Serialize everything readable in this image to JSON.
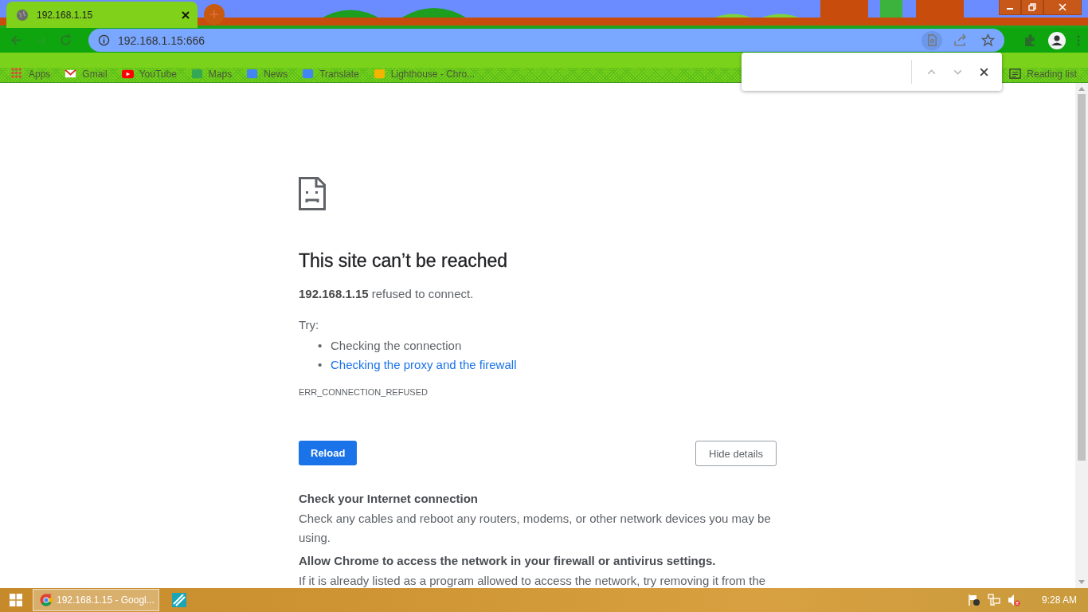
{
  "tab": {
    "title": "192.168.1.15",
    "selected": true
  },
  "toolbar": {
    "url": "192.168.1.15:666"
  },
  "bookmarks": [
    {
      "label": "Apps",
      "kind": "apps"
    },
    {
      "label": "Gmail",
      "kind": "mail"
    },
    {
      "label": "YouTube",
      "kind": "video"
    },
    {
      "label": "Maps",
      "kind": "map"
    },
    {
      "label": "News",
      "kind": "news"
    },
    {
      "label": "Translate",
      "kind": "translate"
    },
    {
      "label": "Lighthouse - Chro...",
      "kind": "page"
    }
  ],
  "reading_list": "Reading list",
  "error": {
    "title": "This site can’t be reached",
    "message": "**192.168.1.15** refused to connect.",
    "try_label": "Try:",
    "suggestions": [
      {
        "bullet": "•",
        "text": "Checking the connection",
        "link": false
      },
      {
        "bullet": "•",
        "text": "Checking the proxy and the firewall",
        "link": true
      }
    ],
    "code": "ERR_CONNECTION_REFUSED",
    "reload": "Reload",
    "details_button": "Hide details",
    "details": [
      {
        "heading": "Check your Internet connection",
        "body": "Check any cables and reboot any routers, modems, or other network devices you may be using."
      },
      {
        "heading": "Allow Chrome to access the network in your firewall or antivirus settings.",
        "body": "If it is already listed as a program allowed to access the network, try removing it from the"
      }
    ]
  },
  "taskbar": {
    "task": "192.168.1.15 - Googl...",
    "clock": "9:28 AM"
  }
}
